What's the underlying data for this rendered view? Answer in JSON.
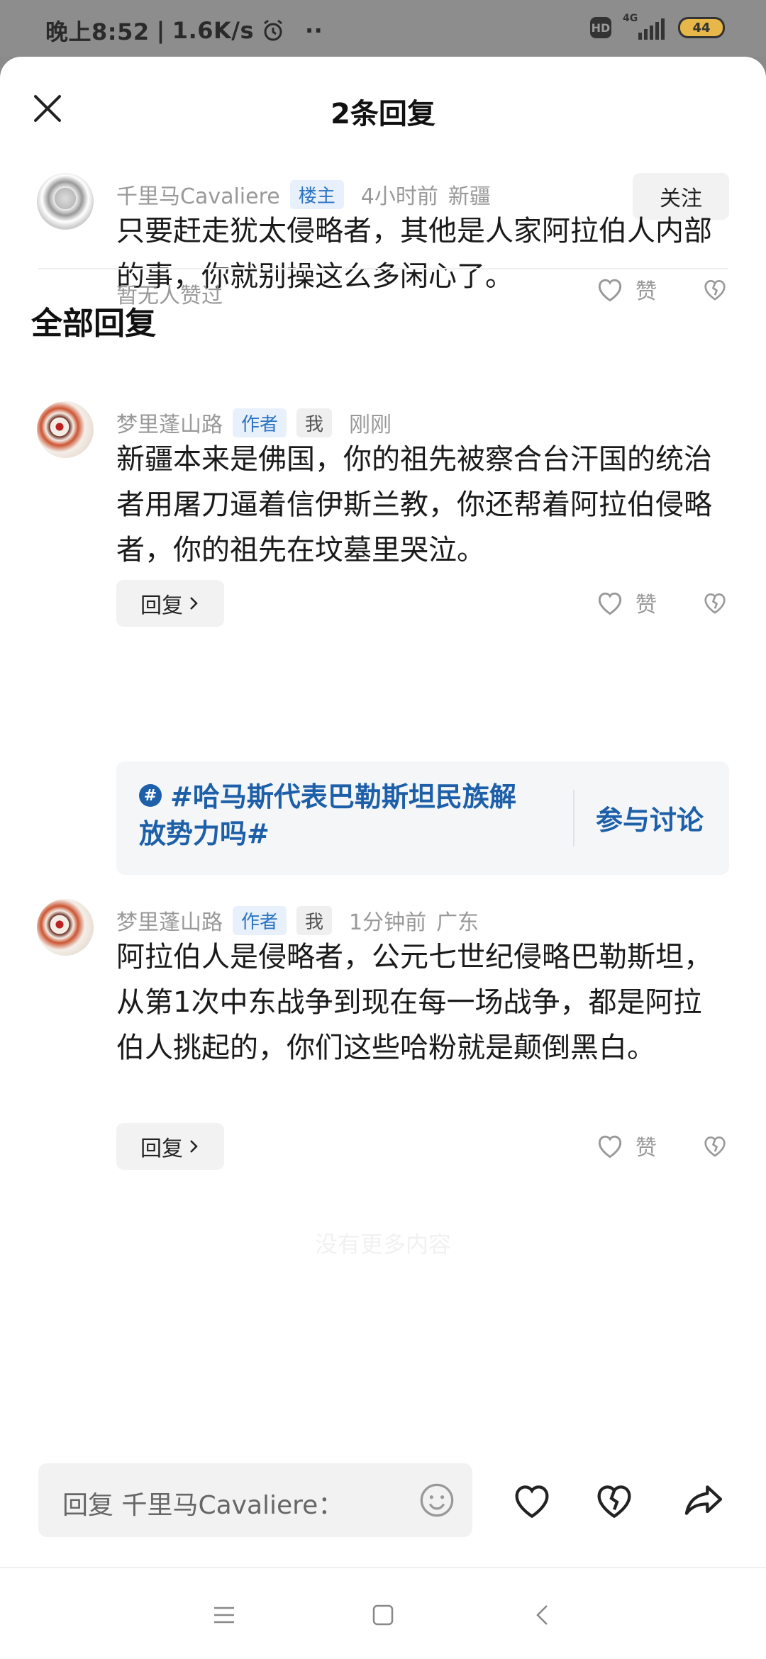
{
  "status": {
    "time": "晚上8:52",
    "speed": "1.6K/s",
    "hd": "HD",
    "network": "4G",
    "battery": "44"
  },
  "header": {
    "title": "2条回复",
    "close_icon": "close-icon"
  },
  "root_comment": {
    "user": "千里马Cavaliere",
    "badge": "楼主",
    "time": "4小时前",
    "location": "新疆",
    "follow_label": "关注",
    "text": "只要赶走犹太侵略者，其他是人家阿拉伯人内部的事，你就别操这么多闲心了。",
    "likes_text": "暂无人赞过",
    "like_label": "赞"
  },
  "section_title": "全部回复",
  "replies": [
    {
      "user": "梦里蓬山路",
      "badge_author": "作者",
      "badge_me": "我",
      "time": "刚刚",
      "location": "",
      "text": "新疆本来是佛国，你的祖先被察合台汗国的统治者用屠刀逼着信伊斯兰教，你还帮着阿拉伯侵略者，你的祖先在坟墓里哭泣。",
      "reply_label": "回复",
      "like_label": "赞"
    },
    {
      "user": "梦里蓬山路",
      "badge_author": "作者",
      "badge_me": "我",
      "time": "1分钟前",
      "location": "广东",
      "text": "阿拉伯人是侵略者，公元七世纪侵略巴勒斯坦，从第1次中东战争到现在每一场战争，都是阿拉伯人挑起的，你们这些哈粉就是颠倒黑白。",
      "reply_label": "回复",
      "like_label": "赞"
    }
  ],
  "topic": {
    "text": "#哈马斯代表巴勒斯坦民族解放势力吗#",
    "join_label": "参与讨论",
    "hash_symbol": "#"
  },
  "loading_text": "没有更多内容",
  "input": {
    "placeholder": "回复 千里马Cavaliere："
  },
  "colors": {
    "accent": "#1d5fa8",
    "badge_blue": "#2b74c4"
  }
}
